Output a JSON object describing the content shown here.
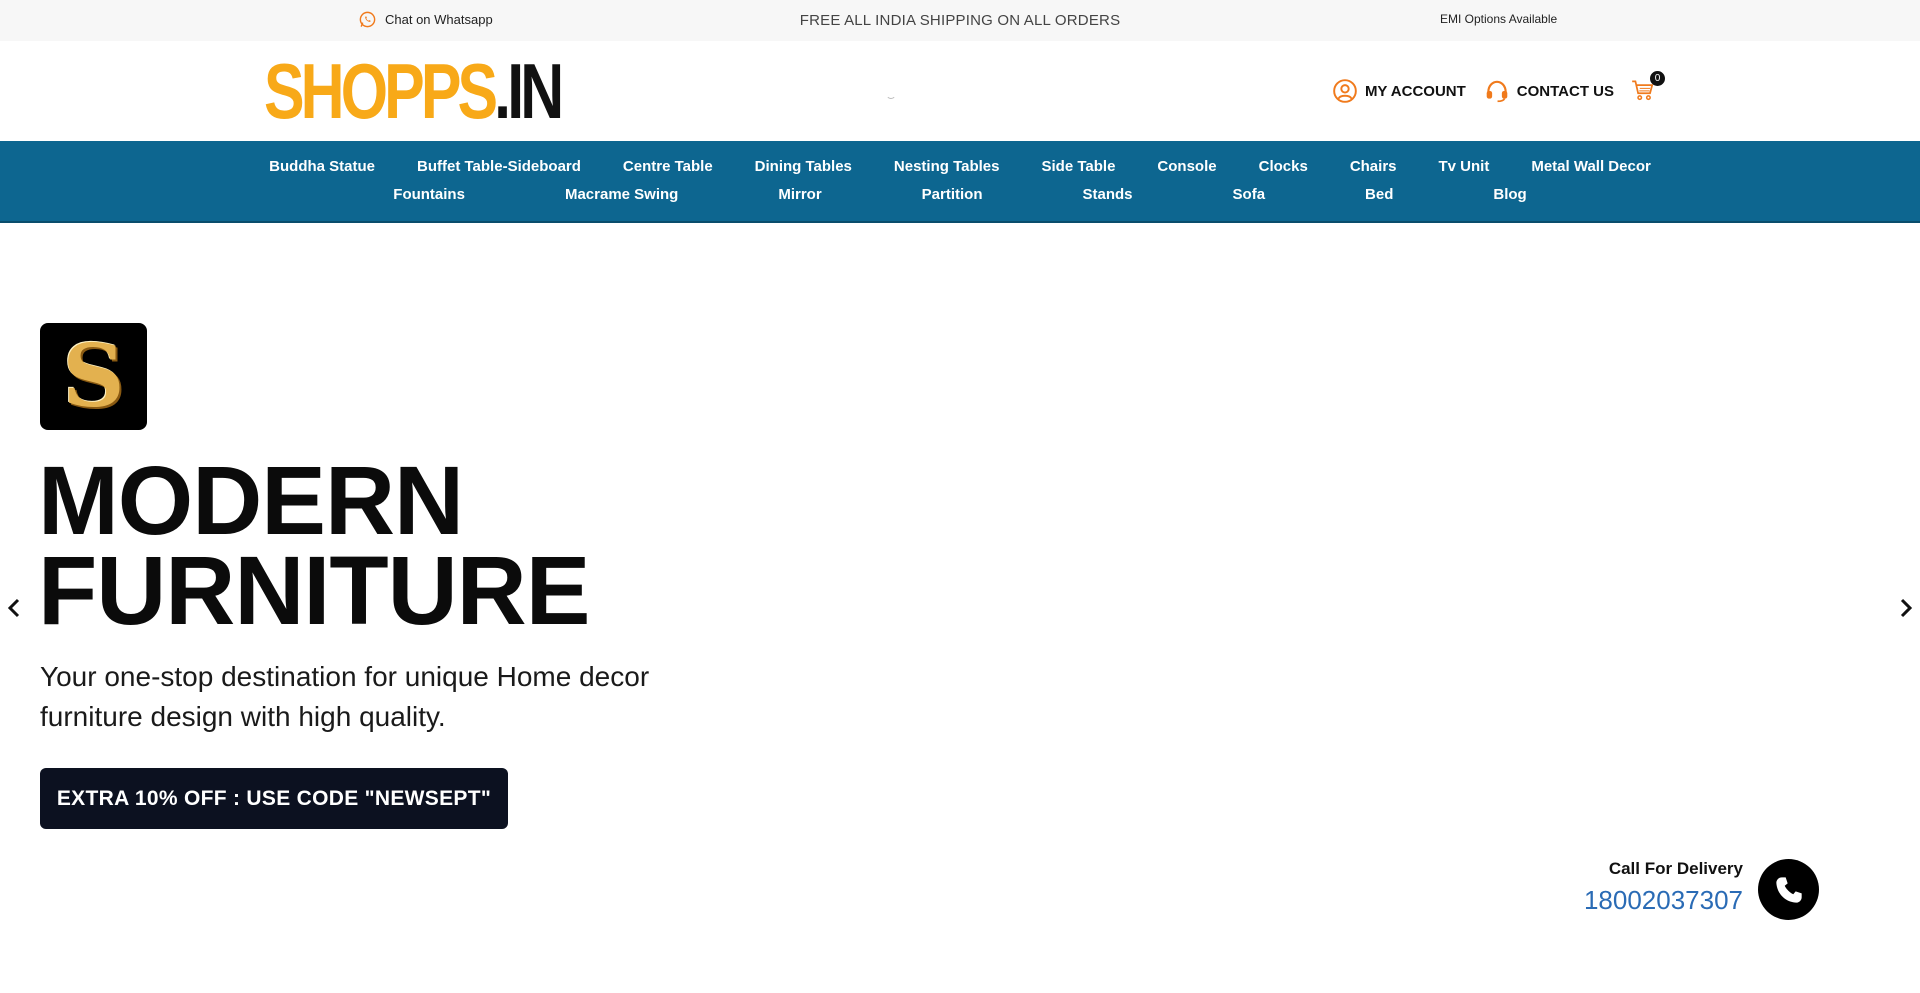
{
  "topbar": {
    "whatsapp_label": "Chat on Whatsapp",
    "whatsapp_icon": "whatsapp-icon",
    "shipping_text": "FREE ALL INDIA SHIPPING ON ALL ORDERS",
    "emi_text": "EMI Options Available"
  },
  "header": {
    "logo_part1": "SHOPPS",
    "logo_part2": ".IN",
    "account_label": "MY ACCOUNT",
    "account_icon": "user-circle-icon",
    "contact_label": "CONTACT US",
    "contact_icon": "headset-icon",
    "cart_icon": "cart-icon",
    "cart_count": "0",
    "accent_color": "#f8a918"
  },
  "nav": {
    "row1": [
      "Buddha Statue",
      "Buffet Table-Sideboard",
      "Centre Table",
      "Dining Tables",
      "Nesting Tables",
      "Side Table",
      "Console",
      "Clocks",
      "Chairs",
      "Tv Unit",
      "Metal Wall Decor"
    ],
    "row2": [
      "Fountains",
      "Macrame Swing",
      "Mirror",
      "Partition",
      "Stands",
      "Sofa",
      "Bed",
      "Blog"
    ],
    "background_color": "#0d6690"
  },
  "hero": {
    "badge_letter": "S",
    "title_line1": "MODERN",
    "title_line2": "FURNITURE",
    "subtitle": "Your one-stop destination for unique Home decor furniture design with high quality.",
    "cta_label": "EXTRA 10% OFF : USE CODE \"NEWSEPT\"",
    "prev_icon": "chevron-left-icon",
    "next_icon": "chevron-right-icon"
  },
  "delivery": {
    "label": "Call For Delivery",
    "number": "18002037307",
    "icon": "phone-icon"
  }
}
